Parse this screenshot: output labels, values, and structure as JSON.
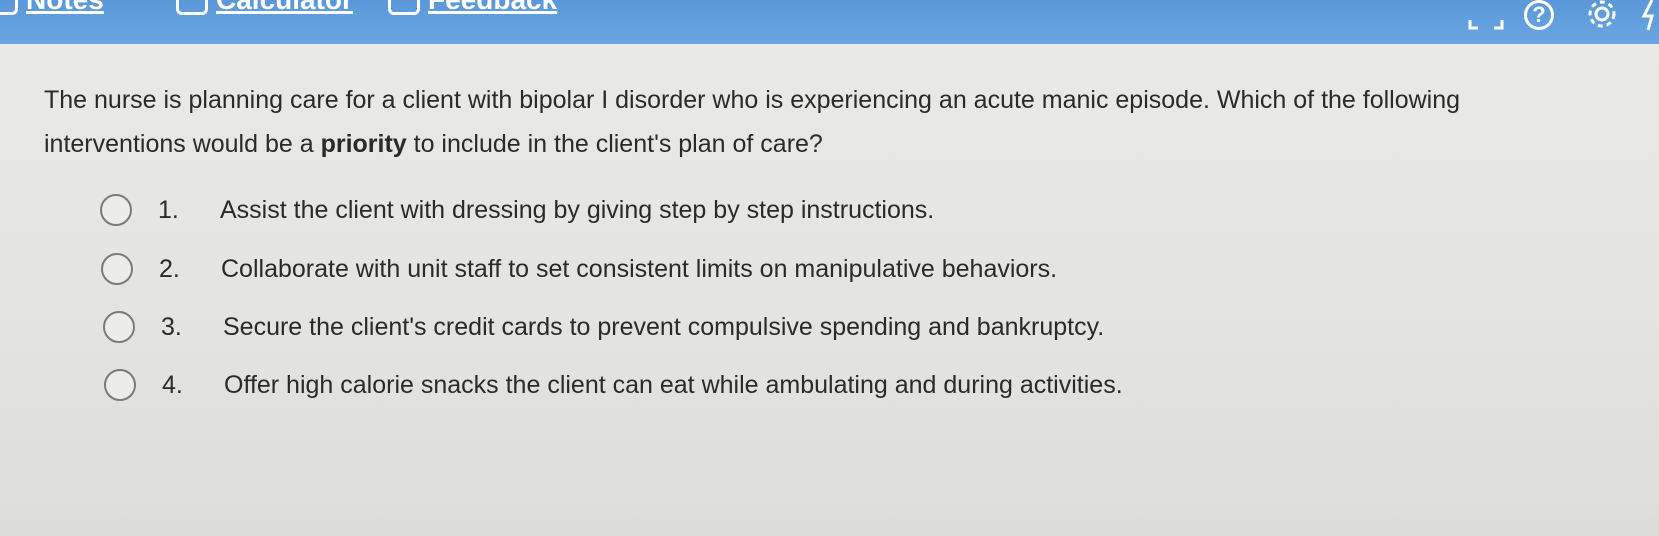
{
  "toolbar": {
    "notes_label": "Notes",
    "calculator_label": "Calculator",
    "feedback_label": "Feedback",
    "icons": [
      "expand-icon",
      "help-icon",
      "gear-icon"
    ],
    "help_glyph": "?",
    "accent_color": "#5b98d9"
  },
  "question": {
    "text_before": "The nurse is planning care for a client with bipolar I disorder who is experiencing an acute manic episode. Which of the following interventions would be a ",
    "emphasis": "priority",
    "text_after": " to include in the client's plan of care?"
  },
  "options": [
    {
      "number": "1.",
      "text": "Assist the client with dressing by giving step by step instructions."
    },
    {
      "number": "2.",
      "text": "Collaborate with unit staff to set consistent limits on manipulative behaviors."
    },
    {
      "number": "3.",
      "text": "Secure the client's credit cards to prevent compulsive spending and bankruptcy."
    },
    {
      "number": "4.",
      "text": "Offer high calorie snacks the client can eat while ambulating and during activities."
    }
  ]
}
